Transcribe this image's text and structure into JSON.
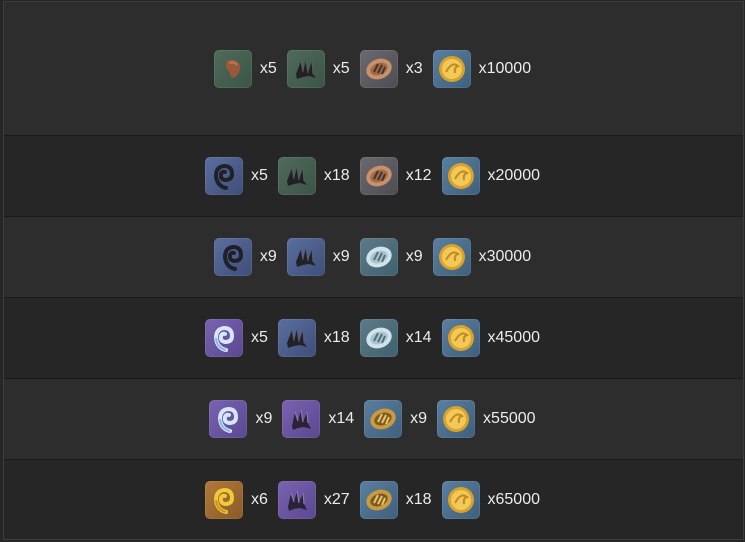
{
  "rows": [
    {
      "items": [
        {
          "icon": "brown-fragment-icon",
          "qty": "x5"
        },
        {
          "icon": "dark-claw-icon",
          "qty": "x5"
        },
        {
          "icon": "bronze-emblem-icon",
          "qty": "x3"
        },
        {
          "icon": "gold-coin-icon",
          "qty": "x10000"
        }
      ]
    },
    {
      "items": [
        {
          "icon": "dark-swirl-icon",
          "qty": "x5"
        },
        {
          "icon": "dark-claw-icon",
          "qty": "x18"
        },
        {
          "icon": "bronze-emblem-icon",
          "qty": "x12"
        },
        {
          "icon": "gold-coin-icon",
          "qty": "x20000"
        }
      ]
    },
    {
      "items": [
        {
          "icon": "dark-swirl-icon",
          "qty": "x9"
        },
        {
          "icon": "dark-claw-icon",
          "qty": "x9"
        },
        {
          "icon": "silver-emblem-icon",
          "qty": "x9"
        },
        {
          "icon": "gold-coin-icon",
          "qty": "x30000"
        }
      ]
    },
    {
      "items": [
        {
          "icon": "blue-swirl-icon",
          "qty": "x5"
        },
        {
          "icon": "dark-claw-icon",
          "qty": "x18"
        },
        {
          "icon": "silver-emblem-icon",
          "qty": "x14"
        },
        {
          "icon": "gold-coin-icon",
          "qty": "x45000"
        }
      ]
    },
    {
      "items": [
        {
          "icon": "blue-swirl-icon",
          "qty": "x9"
        },
        {
          "icon": "purple-claw-icon",
          "qty": "x14"
        },
        {
          "icon": "gold-emblem-icon",
          "qty": "x9"
        },
        {
          "icon": "gold-coin-icon",
          "qty": "x55000"
        }
      ]
    },
    {
      "items": [
        {
          "icon": "gold-swirl-icon",
          "qty": "x6"
        },
        {
          "icon": "purple-claw-icon",
          "qty": "x27"
        },
        {
          "icon": "gold-emblem-icon",
          "qty": "x18"
        },
        {
          "icon": "gold-coin-icon",
          "qty": "x65000"
        }
      ]
    }
  ]
}
